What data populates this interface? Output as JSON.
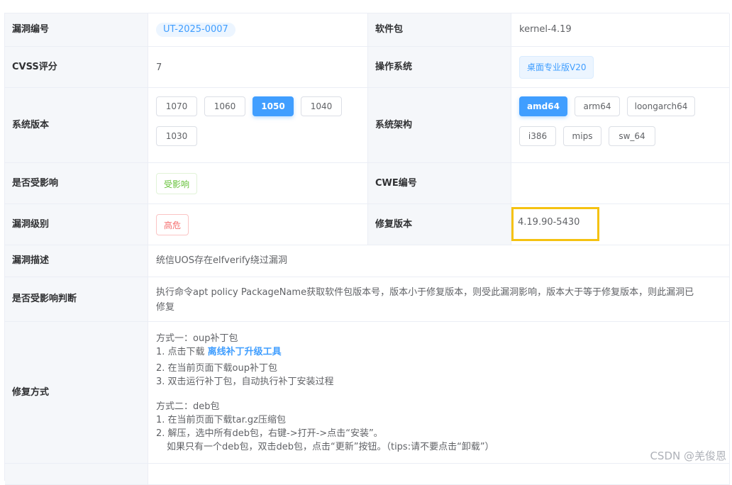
{
  "rows": {
    "vuln_id": {
      "label": "漏洞编号",
      "value": "UT-2025-0007"
    },
    "package": {
      "label": "软件包",
      "value": "kernel-4.19"
    },
    "cvss": {
      "label": "CVSS评分",
      "value": "7"
    },
    "os": {
      "label": "操作系统",
      "value": "桌面专业版V20"
    },
    "sys_version": {
      "label": "系统版本",
      "options": [
        "1070",
        "1060",
        "1050",
        "1040",
        "1030"
      ],
      "selected": "1050"
    },
    "arch": {
      "label": "系统架构",
      "options": [
        "amd64",
        "arm64",
        "loongarch64",
        "i386",
        "mips",
        "sw_64"
      ],
      "selected": "amd64"
    },
    "affected": {
      "label": "是否受影响",
      "value": "受影响"
    },
    "cwe": {
      "label": "CWE编号",
      "value": ""
    },
    "level": {
      "label": "漏洞级别",
      "value": "高危"
    },
    "fix_version": {
      "label": "修复版本",
      "value": "4.19.90-5430"
    },
    "description": {
      "label": "漏洞描述",
      "value": "统信UOS存在elfverify绕过漏洞"
    },
    "judgement": {
      "label": "是否受影响判断",
      "line1": "执行命令apt policy PackageName获取软件包版本号，版本小于修复版本，则受此漏洞影响，版本大于等于修复版本，则此漏洞已",
      "line2": "修复"
    },
    "fix_method": {
      "label": "修复方式",
      "m1_title": "方式一：oup补丁包",
      "m1_s1_prefix": "1. 点击下载 ",
      "m1_s1_link": "离线补丁升级工具",
      "m1_s2": "2. 在当前页面下载oup补丁包",
      "m1_s3": "3. 双击运行补丁包，自动执行补丁安装过程",
      "m2_title": "方式二：deb包",
      "m2_s1": "1. 在当前页面下载tar.gz压缩包",
      "m2_s2": "2. 解压，选中所有deb包，右键->打开->点击“安装”。",
      "m2_s3": "如果只有一个deb包，双击deb包，点击“更新”按钮。（tips:请不要点击“卸载”）"
    }
  },
  "watermark": "CSDN @羌俊恩"
}
